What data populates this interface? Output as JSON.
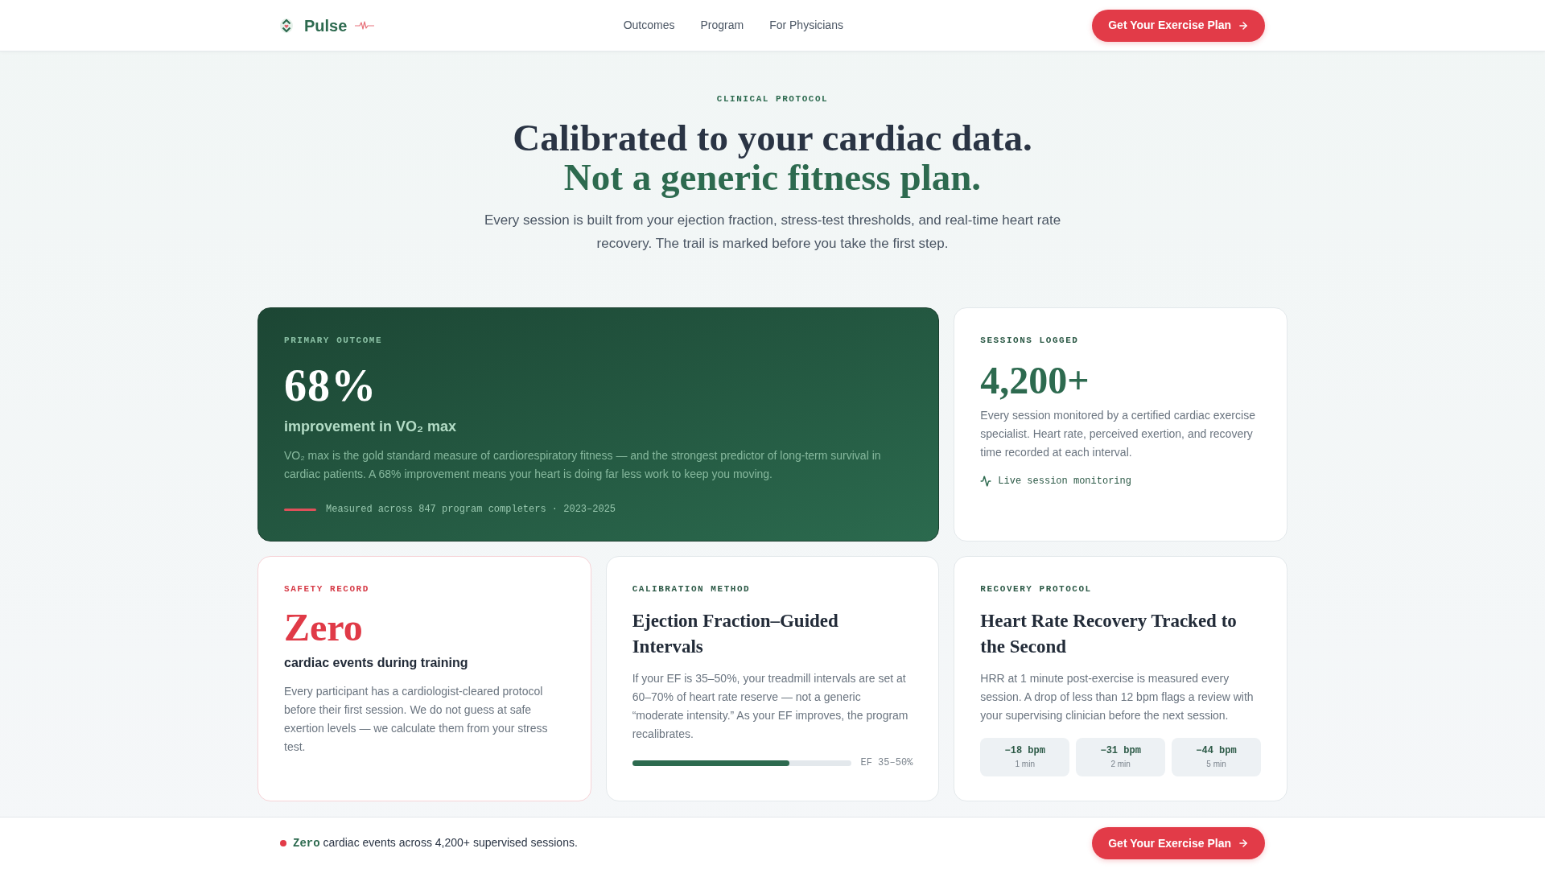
{
  "nav": {
    "brand": "Pulse",
    "links": [
      "Outcomes",
      "Program",
      "For Physicians"
    ],
    "cta": "Get Your Exercise Plan"
  },
  "hero": {
    "eyebrow": "CLINICAL PROTOCOL",
    "headline": "Calibrated to your cardiac data.",
    "headline_accent": "Not a generic fitness plan.",
    "lede": "Every session is built from your ejection fraction, stress-test thresholds, and real-time heart rate recovery. The trail is marked before you take the first step."
  },
  "cards": [
    {
      "kind": "primary",
      "label": "PRIMARY OUTCOME",
      "stat": "68%",
      "subtitle": "improvement in VO₂ max",
      "body": "VO₂ max is the gold standard measure of cardiorespiratory fitness — and the strongest predictor of long-term survival in cardiac patients. A 68% improvement means your heart is doing far less work to keep you moving.",
      "footnote": "Measured across 847 program completers · 2023–2025"
    },
    {
      "kind": "stat",
      "label": "SESSIONS LOGGED",
      "stat": "4,200+",
      "body": "Every session monitored by a certified cardiac exercise specialist. Heart rate, perceived exertion, and recovery time recorded at each interval.",
      "footnote": "Live session monitoring"
    },
    {
      "kind": "safety",
      "label": "SAFETY RECORD",
      "stat": "Zero",
      "subtitle": "cardiac events during training",
      "body": "Every participant has a cardiologist-cleared protocol before their first session. We do not guess at safe exertion levels — we calculate them from your stress test."
    },
    {
      "kind": "progress",
      "label": "CALIBRATION METHOD",
      "title": "Ejection Fraction–Guided Intervals",
      "body": "If your EF is 35–50%, your treadmill intervals are set at 60–70% of heart rate reserve — not a generic “moderate intensity.” As your EF improves, the program recalibrates.",
      "level": 0.72,
      "reading": "EF 35–50%"
    },
    {
      "kind": "metrics",
      "label": "RECOVERY PROTOCOL",
      "title": "Heart Rate Recovery Tracked to the Second",
      "body": "HRR at 1 minute post-exercise is measured every session. A drop of less than 12 bpm flags a review with your supervising clinician before the next session.",
      "metrics": [
        {
          "value": "−18 bpm",
          "label": "1 min"
        },
        {
          "value": "−31 bpm",
          "label": "2 min"
        },
        {
          "value": "−44 bpm",
          "label": "5 min"
        }
      ]
    }
  ],
  "bottom_bar": {
    "text": "**Zero** cardiac events across 4,200+ supervised sessions.",
    "cta": "Get Your Exercise Plan"
  }
}
